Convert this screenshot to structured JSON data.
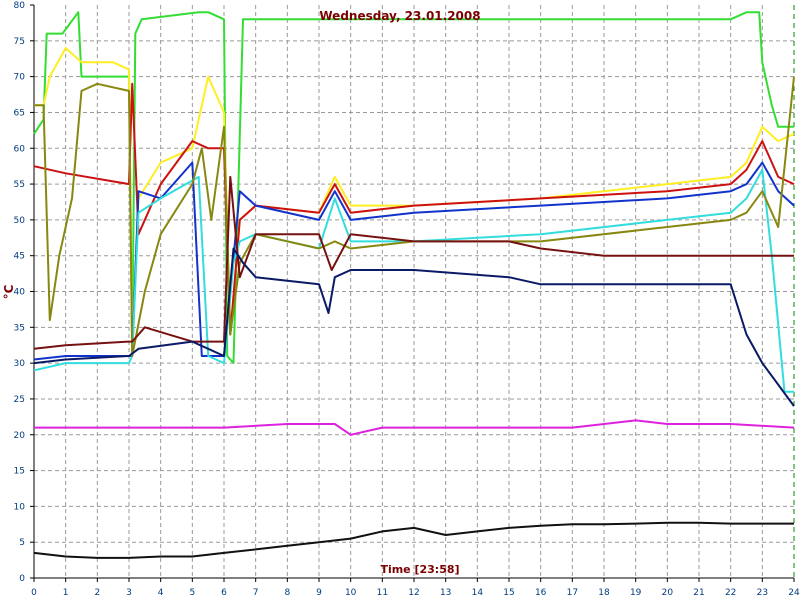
{
  "chart_data": {
    "type": "line",
    "title": "Wednesday, 23.01.2008",
    "ylabel": "°C",
    "xlabel": "Time [23:58]",
    "xlim": [
      0,
      24
    ],
    "ylim": [
      0,
      80
    ],
    "x_ticks": [
      "0",
      "1",
      "2",
      "3",
      "4",
      "5",
      "6",
      "7",
      "8",
      "9",
      "10",
      "11",
      "12",
      "13",
      "14",
      "15",
      "16",
      "17",
      "18",
      "19",
      "20",
      "21",
      "22",
      "23",
      "24"
    ],
    "y_ticks": [
      "0",
      "5",
      "10",
      "15",
      "20",
      "25",
      "30",
      "35",
      "40",
      "45",
      "50",
      "55",
      "60",
      "65",
      "70",
      "75",
      "80"
    ],
    "grid": true,
    "series": [
      {
        "color": "#33dd33",
        "x": [
          0,
          0.3,
          0.4,
          0.9,
          1.4,
          1.5,
          3.0,
          3.1,
          3.2,
          3.4,
          5.2,
          5.5,
          6.0,
          6.1,
          6.3,
          6.6,
          8,
          12,
          16,
          20,
          22.0,
          22.5,
          22.9,
          23.0,
          23.3,
          23.5,
          24
        ],
        "values": [
          62,
          64,
          76,
          76,
          79,
          70,
          70,
          31,
          76,
          78,
          79,
          79,
          78,
          31,
          30,
          78,
          78,
          78,
          78,
          78,
          78,
          79,
          79,
          72,
          66,
          63,
          63
        ]
      },
      {
        "color": "#ffee22",
        "x": [
          0,
          0.3,
          0.5,
          1.0,
          1.5,
          2.5,
          3.0,
          3.1,
          3.3,
          4,
          5.0,
          5.5,
          6.0,
          6.2,
          6.5,
          7,
          9,
          9.5,
          10,
          12,
          16,
          20,
          22,
          22.5,
          23,
          23.5,
          24
        ],
        "values": [
          66,
          66,
          70,
          74,
          72,
          72,
          71,
          32,
          53,
          58,
          60,
          70,
          65,
          34,
          50,
          52,
          51,
          56,
          52,
          52,
          53,
          55,
          56,
          58,
          63,
          61,
          62
        ]
      },
      {
        "color": "#cc1111",
        "x": [
          0,
          1,
          3,
          3.1,
          3.3,
          4,
          5.0,
          5.5,
          6.0,
          6.2,
          6.5,
          7,
          9,
          9.5,
          10,
          12,
          16,
          20,
          22,
          22.5,
          23,
          23.5,
          24
        ],
        "values": [
          57.5,
          56.5,
          55,
          69,
          48,
          55,
          61,
          60,
          60,
          34,
          50,
          52,
          51,
          55,
          51,
          52,
          53,
          54,
          55,
          57,
          61,
          56,
          55
        ]
      },
      {
        "color": "#1133cc",
        "x": [
          0,
          1,
          3,
          3.1,
          3.3,
          4,
          5.0,
          5.3,
          6.0,
          6.2,
          6.5,
          7,
          9,
          9.5,
          10,
          12,
          16,
          20,
          22,
          22.5,
          23,
          23.5,
          24
        ],
        "values": [
          30.5,
          31,
          31,
          31,
          54,
          53,
          58,
          31,
          31,
          40,
          54,
          52,
          50,
          54,
          50,
          51,
          52,
          53,
          54,
          55,
          58,
          54,
          52
        ]
      },
      {
        "color": "#33dddd",
        "x": [
          0,
          1,
          3,
          3.1,
          3.3,
          4,
          5.2,
          5.5,
          6.0,
          6.3,
          6.5,
          7,
          9,
          9.5,
          10,
          12,
          16,
          20,
          22,
          22.5,
          23,
          23.3,
          23.7,
          24
        ],
        "values": [
          29,
          30,
          30,
          31,
          51,
          53,
          56,
          31,
          30,
          44,
          47,
          48,
          46,
          53,
          47,
          47,
          48,
          50,
          51,
          53,
          57,
          45,
          26,
          26
        ]
      },
      {
        "color": "#888811",
        "x": [
          0,
          0.3,
          0.5,
          0.8,
          1.2,
          1.5,
          2,
          3,
          3.1,
          3.5,
          4,
          5,
          5.3,
          5.6,
          6.0,
          6.2,
          6.5,
          7,
          9,
          9.5,
          10,
          12,
          16,
          20,
          22,
          22.5,
          23,
          23.5,
          24
        ],
        "values": [
          66,
          66,
          36,
          45,
          53,
          68,
          69,
          68,
          31,
          40,
          48,
          55,
          60,
          50,
          63,
          34,
          44,
          48,
          46,
          47,
          46,
          47,
          47,
          49,
          50,
          51,
          54,
          49,
          70
        ]
      },
      {
        "color": "#771111",
        "x": [
          0,
          1,
          3,
          3.1,
          3.5,
          5,
          6.0,
          6.2,
          6.5,
          7,
          9,
          9.4,
          10,
          12,
          15,
          16,
          18,
          20,
          22,
          22.5,
          23,
          24
        ],
        "values": [
          32,
          32.5,
          33,
          33,
          35,
          33,
          33,
          56,
          42,
          48,
          48,
          43,
          48,
          47,
          47,
          46,
          45,
          45,
          45,
          45,
          45,
          45
        ]
      },
      {
        "color": "#0a1a66",
        "x": [
          0,
          1,
          3,
          3.3,
          5,
          5.5,
          6.0,
          6.3,
          6.6,
          7,
          9,
          9.3,
          9.5,
          10,
          12,
          15,
          16,
          18,
          20,
          22,
          22.5,
          23,
          23.5,
          24
        ],
        "values": [
          30,
          30.5,
          31,
          32,
          33,
          32,
          31,
          46,
          44,
          42,
          41,
          37,
          42,
          43,
          43,
          42,
          41,
          41,
          41,
          41,
          34,
          30,
          27,
          24
        ]
      },
      {
        "color": "#dd22dd",
        "x": [
          0,
          2,
          4,
          6,
          8,
          9.5,
          10,
          11,
          13,
          16,
          17,
          19,
          20,
          22,
          24
        ],
        "values": [
          21,
          21,
          21,
          21,
          21.5,
          21.5,
          20,
          21,
          21,
          21,
          21,
          22,
          21.5,
          21.5,
          21
        ]
      },
      {
        "color": "#111111",
        "x": [
          0,
          1,
          2,
          3,
          4,
          5,
          6,
          7,
          8,
          9,
          10,
          11,
          12,
          13,
          14,
          15,
          16,
          17,
          18,
          19,
          20,
          21,
          22,
          23,
          24
        ],
        "values": [
          3.5,
          3,
          2.8,
          2.8,
          3,
          3,
          3.5,
          4,
          4.5,
          5,
          5.5,
          6.5,
          7,
          6,
          6.5,
          7,
          7.3,
          7.5,
          7.5,
          7.6,
          7.7,
          7.7,
          7.6,
          7.6,
          7.6
        ]
      }
    ]
  }
}
